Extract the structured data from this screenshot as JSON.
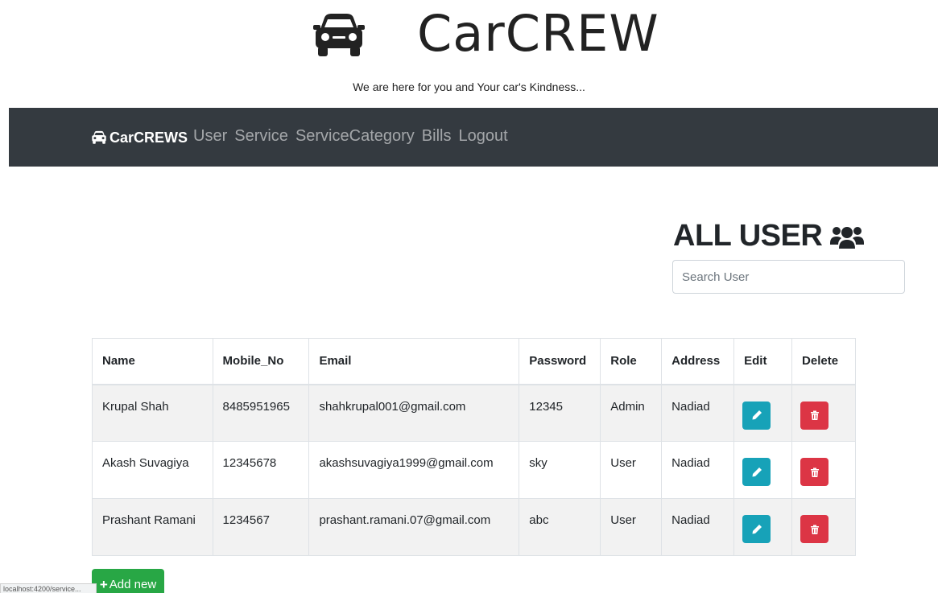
{
  "header": {
    "brand_icon": "car-icon",
    "title": "CarCREW",
    "tagline": "We are here for you and Your car's Kindness..."
  },
  "navbar": {
    "brand_icon": "car-icon",
    "brand_label": "CarCREWS",
    "links": [
      "User",
      "Service",
      "ServiceCategory",
      "Bills",
      "Logout"
    ]
  },
  "main": {
    "heading": "ALL USER",
    "heading_icon": "users-icon",
    "search": {
      "placeholder": "Search User",
      "value": ""
    },
    "table": {
      "columns": [
        "Name",
        "Mobile_No",
        "Email",
        "Password",
        "Role",
        "Address",
        "Edit",
        "Delete"
      ],
      "rows": [
        {
          "name": "Krupal Shah",
          "mobile": "8485951965",
          "email": "shahkrupal001@gmail.com",
          "password": "12345",
          "role": "Admin",
          "address": "Nadiad"
        },
        {
          "name": "Akash Suvagiya",
          "mobile": "12345678",
          "email": "akashsuvagiya1999@gmail.com",
          "password": "sky",
          "role": "User",
          "address": "Nadiad"
        },
        {
          "name": "Prashant Ramani",
          "mobile": "1234567",
          "email": "prashant.ramani.07@gmail.com",
          "password": "abc",
          "role": "User",
          "address": "Nadiad"
        }
      ],
      "edit_icon": "pencil-icon",
      "delete_icon": "trash-icon"
    },
    "add_button": {
      "label": "Add new",
      "icon": "plus-icon"
    }
  },
  "status_bar": {
    "text": "localhost:4200/service..."
  },
  "colors": {
    "navbar_bg": "#343a40",
    "edit_button": "#17a2b8",
    "delete_button": "#dc3545",
    "add_button": "#28a745"
  }
}
